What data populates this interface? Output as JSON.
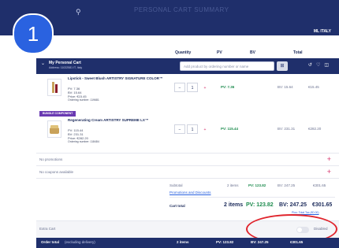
{
  "header": {
    "search_icon": "search-icon",
    "faded_title": "PERSONAL CART SUMMARY",
    "country": "ML ITALY"
  },
  "step_badge": "1",
  "columns": {
    "quantity": "Quantity",
    "pv": "PV",
    "bv": "BV",
    "total": "Total"
  },
  "cart": {
    "title": "My Personal Cart",
    "subtitle": "Address: 11022581 IT, Italy",
    "add_placeholder": "Add product by ordering number or name"
  },
  "items": [
    {
      "name": "Lipstick - Sweet Blush ARTISTRY SIGNATURE COLOR™",
      "pv": "PV: 7.36",
      "bv": "BV: 15.64",
      "price": "Price: €15.45",
      "ordering": "Ordering number: 119681",
      "qty": "1",
      "pv_col": "PV: 7.36",
      "bv_col": "BV: 15.64",
      "total": "€15.45"
    },
    {
      "badge": "BUNDLE COMPONENT",
      "name": "Regenerating Cream ARTISTRY SUPREME LX™",
      "pv": "PV: 115.44",
      "bv": "BV: 231.31",
      "price": "Price: €282.20",
      "ordering": "Ordering number: 118484",
      "qty": "1",
      "pv_col": "PV: 115.44",
      "bv_col": "BV: 231.31",
      "total": "€282.20"
    }
  ],
  "promotions": "No promotions",
  "coupons": "No coupons available",
  "summary": {
    "subtotal_label": "Subtotal",
    "subtotal_items": "2 items",
    "subtotal_pv": "PV: 123.82",
    "subtotal_bv": "BV: 247.25",
    "subtotal_total": "€301.65",
    "promotions_link": "Promotions and Discounts",
    "cart_total_label": "Cart total",
    "cart_total_items": "2 items",
    "cart_total_pv": "PV: 123.82",
    "cart_total_bv": "BV: 247.25",
    "cart_total_total": "€301.65",
    "tax_link": "Plus: Total Tax (€0.00)"
  },
  "extra_cart": {
    "label": "Extra Cart",
    "toggle_label": "Disabled"
  },
  "footer": {
    "label": "Order total",
    "note": "(excluding delivery)",
    "items": "2 items",
    "pv": "PV: 123.82",
    "bv": "BV: 247.25",
    "total": "€301.65"
  },
  "colors": {
    "brand": "#1f2f6b",
    "accent": "#2a62e0",
    "pv_green": "#1e8c4f",
    "delete": "#d6336c",
    "highlight": "#e0252d"
  }
}
